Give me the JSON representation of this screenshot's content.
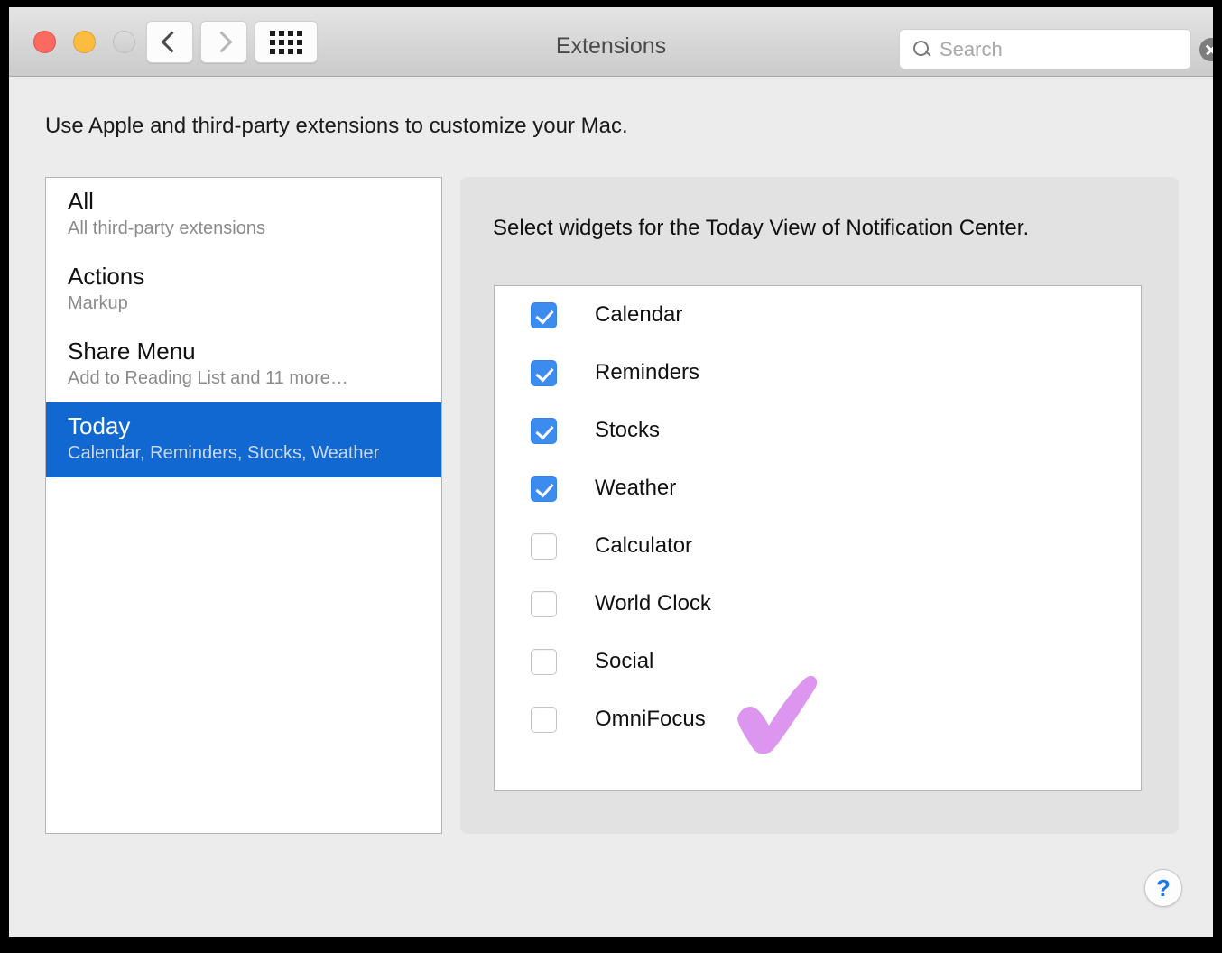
{
  "window": {
    "title": "Extensions",
    "traffic_lights": [
      "close",
      "minimize",
      "zoom"
    ]
  },
  "toolbar": {
    "back_icon": "chevron-left-icon",
    "forward_icon": "chevron-right-icon",
    "show_all_icon": "grid-icon",
    "search": {
      "placeholder": "Search",
      "value": "",
      "icon": "search-icon",
      "clear_icon": "clear-icon"
    }
  },
  "intro_text": "Use Apple and third-party extensions to customize your Mac.",
  "sidebar": {
    "items": [
      {
        "title": "All",
        "subtitle": "All third-party extensions",
        "selected": false
      },
      {
        "title": "Actions",
        "subtitle": "Markup",
        "selected": false
      },
      {
        "title": "Share Menu",
        "subtitle": "Add to Reading List and 11 more…",
        "selected": false
      },
      {
        "title": "Today",
        "subtitle": "Calendar, Reminders, Stocks, Weather",
        "selected": true
      }
    ]
  },
  "panel": {
    "heading": "Select widgets for the Today View of Notification Center.",
    "widgets": [
      {
        "label": "Calendar",
        "checked": true
      },
      {
        "label": "Reminders",
        "checked": true
      },
      {
        "label": "Stocks",
        "checked": true
      },
      {
        "label": "Weather",
        "checked": true
      },
      {
        "label": "Calculator",
        "checked": false
      },
      {
        "label": "World Clock",
        "checked": false
      },
      {
        "label": "Social",
        "checked": false
      },
      {
        "label": "OmniFocus",
        "checked": false
      }
    ]
  },
  "annotation": {
    "shape": "checkmark",
    "color": "#dd96f0",
    "near": "OmniFocus"
  },
  "help_button": {
    "label": "?"
  },
  "colors": {
    "accent_blue": "#3c8cf0",
    "selection_blue": "#1068d0",
    "annotation_purple": "#dd96f0",
    "window_bg": "#ececec",
    "panel_bg": "#e2e2e2"
  }
}
